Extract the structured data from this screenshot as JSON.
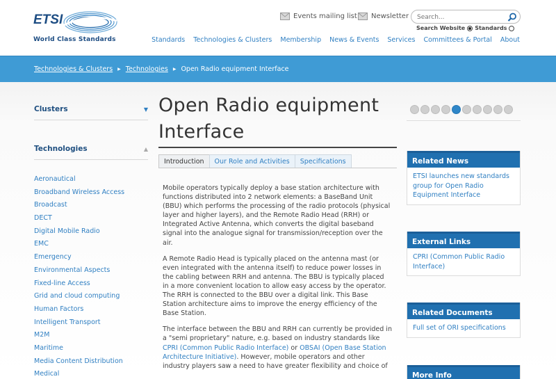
{
  "header": {
    "logo_text": "ETSI",
    "tagline": "World Class Standards",
    "events_label": "Events mailing list",
    "newsletter_label": "Newsletter",
    "search_placeholder": "Search...",
    "search_website_label": "Search Website",
    "standards_label": "Standards"
  },
  "nav": [
    "Standards",
    "Technologies & Clusters",
    "Membership",
    "News & Events",
    "Services",
    "Committees & Portal",
    "About"
  ],
  "breadcrumb": {
    "level1": "Technologies & Clusters",
    "level2": "Technologies",
    "current": "Open Radio equipment Interface"
  },
  "sidebar": {
    "clusters_heading": "Clusters",
    "technologies_heading": "Technologies",
    "items": [
      "Aeronautical",
      "Broadband Wireless Access",
      "Broadcast",
      "DECT",
      "Digital Mobile Radio",
      "EMC",
      "Emergency",
      "Environmental Aspects",
      "Fixed-line Access",
      "Grid and cloud computing",
      "Human Factors",
      "Intelligent Transport",
      "M2M",
      "Maritime",
      "Media Content Distribution",
      "Medical"
    ]
  },
  "main": {
    "title_line1": "Open Radio equipment",
    "title_line2": "Interface",
    "tabs": [
      "Introduction",
      "Our Role and Activities",
      "Specifications"
    ],
    "para1": "Mobile operators typically deploy a base station architecture with functions distributed into 2 network elements: a BaseBand Unit (BBU) which performs the processing of the radio protocols (physical layer and higher layers), and the Remote Radio Head (RRH) or Integrated Active Antenna, which converts the digital baseband signal into the analogue signal for transmission/reception over the air.",
    "para2": "A Remote Radio Head is typically placed on the antenna mast (or even integrated with the antenna itself) to reduce power losses in the cabling between RRH and antenna. The BBU is typically placed in a more convenient location to allow easy access by the operator. The RRH is connected to the BBU over a digital link. This Base Station architecture aims to improve the energy efficiency of the Base Station.",
    "para3_a": "The interface between the BBU and RRH can currently be provided in a \"semi proprietary\" nature, e.g. based on industry standards like ",
    "para3_link1": "CPRI (Common Public Radio Interface)",
    "para3_b": " or ",
    "para3_link2": "OBSAI (Open Base Station Architecture Initiative)",
    "para3_c": ". However, mobile operators and other industry players saw a need to have greater flexibility and choice of"
  },
  "right": {
    "carousel_count": 10,
    "carousel_active": 5,
    "related_news_title": "Related News",
    "related_news_item": "ETSI launches new standards group for Open Radio Equipment Interface",
    "external_links_title": "External Links",
    "external_links_item": "CPRI (Common Public Radio Interface)",
    "related_docs_title": "Related Documents",
    "related_docs_item": "Full set of ORI specifications",
    "more_info_title": "More Info"
  },
  "colors": {
    "brand_blue": "#1d4d83",
    "link_blue": "#2f7fc2",
    "breadcrumb_bar": "#3f9bd5",
    "box_header": "#2070b0"
  }
}
